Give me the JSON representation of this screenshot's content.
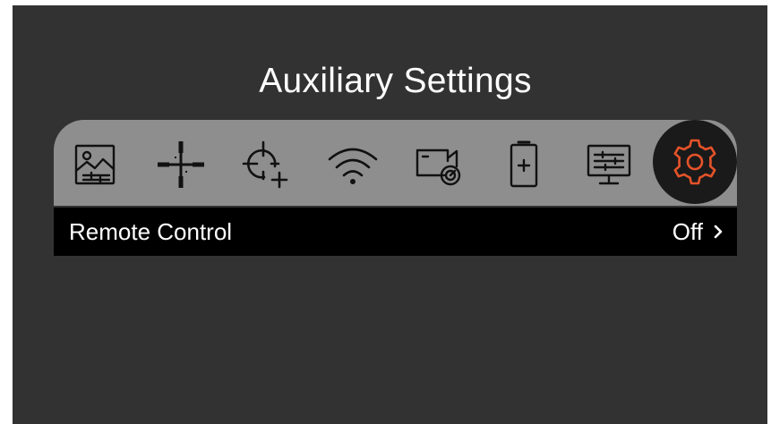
{
  "page": {
    "title": "Auxiliary Settings"
  },
  "tabs": [
    {
      "icon": "image-adjust-icon",
      "active": false
    },
    {
      "icon": "reticle-crosshair-icon",
      "active": false
    },
    {
      "icon": "zeroing-crosshair-plus-icon",
      "active": false
    },
    {
      "icon": "wifi-icon",
      "active": false
    },
    {
      "icon": "video-record-icon",
      "active": false
    },
    {
      "icon": "battery-icon",
      "active": false
    },
    {
      "icon": "display-settings-icon",
      "active": false
    },
    {
      "icon": "gear-icon",
      "active": true
    }
  ],
  "settings_list": {
    "items": [
      {
        "label": "Remote Control",
        "value": "Off",
        "icon": "chevron-right-icon"
      }
    ]
  },
  "colors": {
    "background": "#323232",
    "tab_bar": "#8e8e8e",
    "active_tab_bg": "#1a1a1a",
    "accent": "#e5532a",
    "icon": "#111111",
    "row_bg": "#000000",
    "text": "#ffffff"
  }
}
